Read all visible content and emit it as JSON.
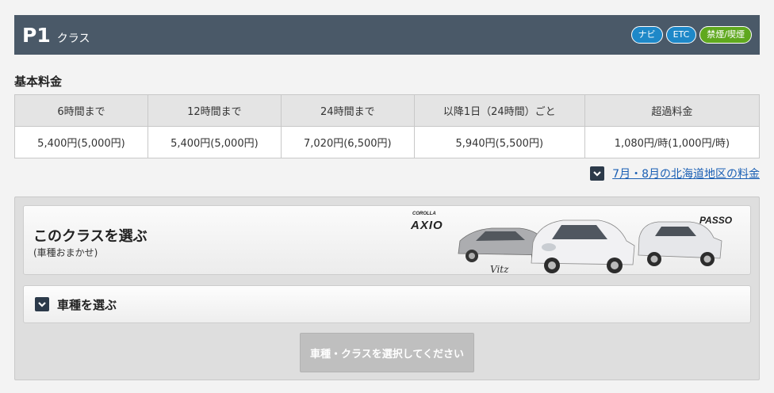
{
  "header": {
    "class_code": "P1",
    "class_suffix": "クラス",
    "badges": [
      {
        "label": "ナビ",
        "color": "#1e88c8"
      },
      {
        "label": "ETC",
        "color": "#1e88c8"
      },
      {
        "label": "禁煙/喫煙",
        "color": "#5fa81e"
      }
    ]
  },
  "rates": {
    "title": "基本料金",
    "columns": [
      "6時間まで",
      "12時間まで",
      "24時間まで",
      "以降1日（24時間）ごと",
      "超過料金"
    ],
    "values": [
      "5,400円(5,000円)",
      "5,400円(5,000円)",
      "7,020円(6,500円)",
      "5,940円(5,500円)",
      "1,080円/時(1,000円/時)"
    ]
  },
  "region_link": "7月・8月の北海道地区の料金",
  "choose_class": {
    "title": "このクラスを選ぶ",
    "subtitle": "(車種おまかせ)",
    "car_logos": {
      "axio_brand": "COROLLA",
      "axio": "AXIO",
      "passo": "PASSO",
      "vitz": "Vitz"
    }
  },
  "choose_model": {
    "label": "車種を選ぶ"
  },
  "select_button": "車種・クラスを選択してください",
  "colors": {
    "header_bg": "#4a5968",
    "link": "#1a5fb4",
    "badge_blue": "#1e88c8",
    "badge_green": "#5fa81e"
  }
}
